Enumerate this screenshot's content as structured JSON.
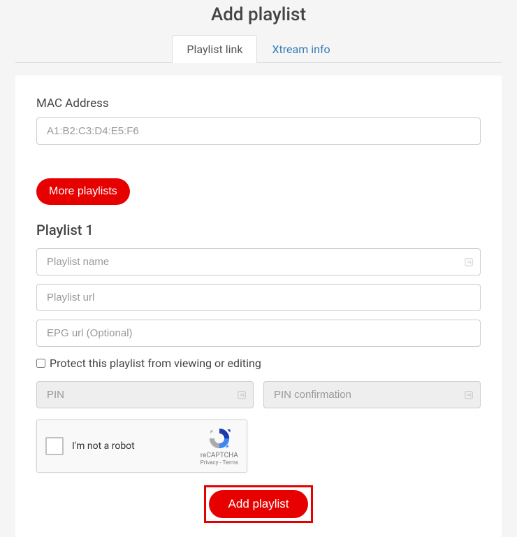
{
  "title": "Add playlist",
  "tabs": {
    "playlist_link": "Playlist link",
    "xtream_info": "Xtream info"
  },
  "mac": {
    "label": "MAC Address",
    "placeholder": "A1:B2:C3:D4:E5:F6",
    "value": ""
  },
  "more_playlists_label": "More playlists",
  "playlist_section_title": "Playlist 1",
  "playlist": {
    "name_placeholder": "Playlist name",
    "url_placeholder": "Playlist url",
    "epg_placeholder": "EPG url (Optional)"
  },
  "protect": {
    "label": "Protect this playlist from viewing or editing",
    "checked": false
  },
  "pin": {
    "placeholder": "PIN",
    "confirm_placeholder": "PIN confirmation"
  },
  "recaptcha": {
    "label": "I'm not a robot",
    "brand": "reCAPTCHA",
    "links": "Privacy - Terms"
  },
  "submit_label": "Add playlist"
}
